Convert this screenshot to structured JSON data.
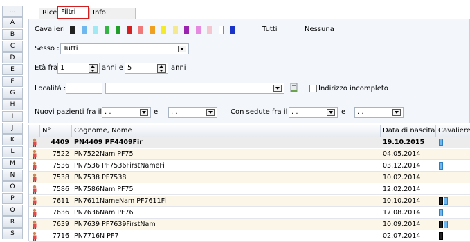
{
  "letters": [
    "...",
    "A",
    "B",
    "C",
    "D",
    "E",
    "F",
    "G",
    "H",
    "I",
    "J",
    "K",
    "L",
    "M",
    "N",
    "O",
    "P",
    "Q",
    "R",
    "S"
  ],
  "tabs": [
    {
      "label": "Ricerca",
      "active": false
    },
    {
      "label": "Filtri",
      "active": true
    },
    {
      "label": "Info Paziente",
      "active": false
    }
  ],
  "filters": {
    "cavalieri_label": "Cavalieri",
    "swatches": [
      "#222222",
      "#6fb8ef",
      "#9fe8f4",
      "#35b544",
      "#1f9f2a",
      "#d42020",
      "#f07a7a",
      "#f0a020",
      "#f2ea2a",
      "#f4e890",
      "#9a23b0",
      "#e689e0",
      "#f4c6cf",
      "#ffffff",
      "#1a33c8"
    ],
    "tutti": "Tutti",
    "nessuna": "Nessuna",
    "sesso_label": "Sesso :",
    "sesso_value": "Tutti",
    "eta_label": "Età fra",
    "eta_from": "1",
    "eta_and": "anni e",
    "eta_to": "5",
    "eta_unit": "anni",
    "localita_label": "Località :",
    "localita_cap": "",
    "localita_city": "",
    "indirizzo_label": "Indirizzo incompleto",
    "nuovi_label": "Nuovi pazienti fra il",
    "date_placeholder": " .  .",
    "e_label": "e",
    "sedute_label": "Con sedute fra il"
  },
  "grid": {
    "headers": [
      "N°",
      "Cognome, Nome",
      "Data di nascita",
      "Cavaliere"
    ],
    "rows": [
      {
        "n": "4409",
        "name": "PN4409 PF4409Fir",
        "dob": "19.10.2015",
        "cav": [
          "#6fb8ef"
        ]
      },
      {
        "n": "7522",
        "name": "PN7522Nam PF75",
        "dob": "04.05.2014",
        "cav": []
      },
      {
        "n": "7536",
        "name": "PN7536 PF7536FirstNameFi",
        "dob": "03.12.2014",
        "cav": [
          "#6fb8ef"
        ]
      },
      {
        "n": "7538",
        "name": "PN7538 PF7538",
        "dob": "10.02.2014",
        "cav": []
      },
      {
        "n": "7586",
        "name": "PN7586Nam PF75",
        "dob": "12.02.2014",
        "cav": []
      },
      {
        "n": "7611",
        "name": "PN7611NameNam PF7611Fi",
        "dob": "10.10.2014",
        "cav": [
          "#222222",
          "#6fb8ef"
        ]
      },
      {
        "n": "7636",
        "name": "PN7636Nam PF76",
        "dob": "17.08.2014",
        "cav": [
          "#6fb8ef"
        ]
      },
      {
        "n": "7639",
        "name": "PN7639 PF7639FirstNam",
        "dob": "10.09.2014",
        "cav": [
          "#222222",
          "#6fb8ef"
        ]
      },
      {
        "n": "7716",
        "name": "PN7716N PF7",
        "dob": "02.07.2014",
        "cav": [
          "#222222"
        ]
      }
    ]
  }
}
